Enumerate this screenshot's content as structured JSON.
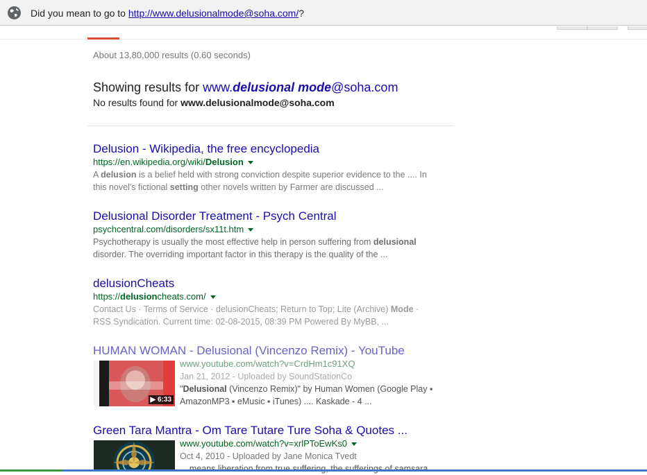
{
  "infobar": {
    "prefix": "Did you mean to go to ",
    "link": "http://www.delusionalmode@soha.com/",
    "suffix": "?"
  },
  "stats": "About 13,80,000 results (0.60 seconds)",
  "showing": {
    "prefix": "Showing results for ",
    "query_a": "www.",
    "query_b": "delusional mode",
    "query_c": "@soha.com"
  },
  "noresults": {
    "prefix": "No results found for ",
    "query": "www.delusionalmode@soha.com"
  },
  "results": [
    {
      "title": "Delusion - Wikipedia, the free encyclopedia",
      "url_a": "https://en.wikipedia.org/wiki/",
      "url_b": "Delusion",
      "snippet_1a": "A ",
      "snippet_1b": "delusion",
      "snippet_1c": " is a belief held with strong conviction despite superior evidence to the .... In",
      "snippet_2a": "this novel's fictional ",
      "snippet_2b": "setting",
      "snippet_2c": " other novels written by Farmer are discussed ..."
    },
    {
      "title": "Delusional Disorder Treatment - Psych Central",
      "url": "psychcentral.com/disorders/sx11t.htm",
      "snippet_1a": "Psychotherapy is usually the most effective help in person suffering from ",
      "snippet_1b": "delusional",
      "snippet_2": "disorder. The overriding important factor in this therapy is the quality of the ..."
    },
    {
      "title": "delusionCheats",
      "url_a": "https://",
      "url_b": "delusion",
      "url_c": "cheats.com/",
      "snippet_1a": "Contact Us · Terms of Service · delusionCheats; Return to Top; Lite (Archive) ",
      "snippet_1b": "Mode",
      "snippet_1c": " ·",
      "snippet_2": "RSS Syndication. Current time: 02-08-2015, 08:39 PM Powered By MyBB, ..."
    },
    {
      "title": "HUMAN WOMAN - Delusional (Vincenzo Remix) - YouTube",
      "url": "www.youtube.com/watch?v=CrdHm1c91XQ",
      "meta": "Jan 21, 2012 - Uploaded by SoundStationCo",
      "snippet_1a": "\"",
      "snippet_1b": "Delusional",
      "snippet_1c": " (Vincenzo Remix)\" by Human Women (Google Play ▪",
      "snippet_2": "AmazonMP3 ▪ eMusic ▪ iTunes) .... Kaskade - 4 ...",
      "duration": "▶ 6:33"
    },
    {
      "title": "Green Tara Mantra - Om Tare Tutare Ture Soha & Quotes ...",
      "url": "www.youtube.com/watch?v=xrlPToEwKs0",
      "meta": "Oct 4, 2010 - Uploaded by Jane Monica Tvedt",
      "snippet_1": "... means liberation from true suffering, the sufferings of samsara ..."
    }
  ],
  "colors": {
    "link": "#1a0dab",
    "url": "#006621",
    "accent": "#dd4b39"
  }
}
